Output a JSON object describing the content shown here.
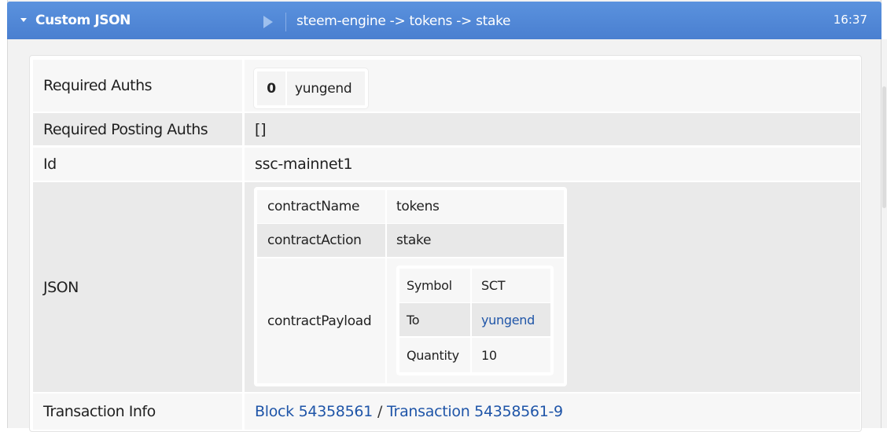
{
  "header": {
    "title": "Custom JSON",
    "path": "steem-engine -> tokens -> stake",
    "time": "16:37"
  },
  "rows": {
    "required_auths": {
      "label": "Required Auths",
      "index": "0",
      "name": "yungend"
    },
    "required_posting_auths": {
      "label": "Required Posting Auths",
      "value": "[]"
    },
    "id": {
      "label": "Id",
      "value": "ssc-mainnet1"
    },
    "json": {
      "label": "JSON",
      "contract_name": {
        "key": "contractName",
        "value": "tokens"
      },
      "contract_action": {
        "key": "contractAction",
        "value": "stake"
      },
      "contract_payload": {
        "key": "contractPayload",
        "symbol": {
          "key": "Symbol",
          "value": "SCT"
        },
        "to": {
          "key": "To",
          "value": "yungend"
        },
        "quantity": {
          "key": "Quantity",
          "value": "10"
        }
      }
    },
    "transaction_info": {
      "label": "Transaction Info",
      "block_link": "Block 54358561",
      "separator": "/",
      "transaction_link": "Transaction 54358561-9"
    }
  },
  "colors": {
    "header_bg": "#4a7fd0",
    "link": "#1f55a8"
  }
}
